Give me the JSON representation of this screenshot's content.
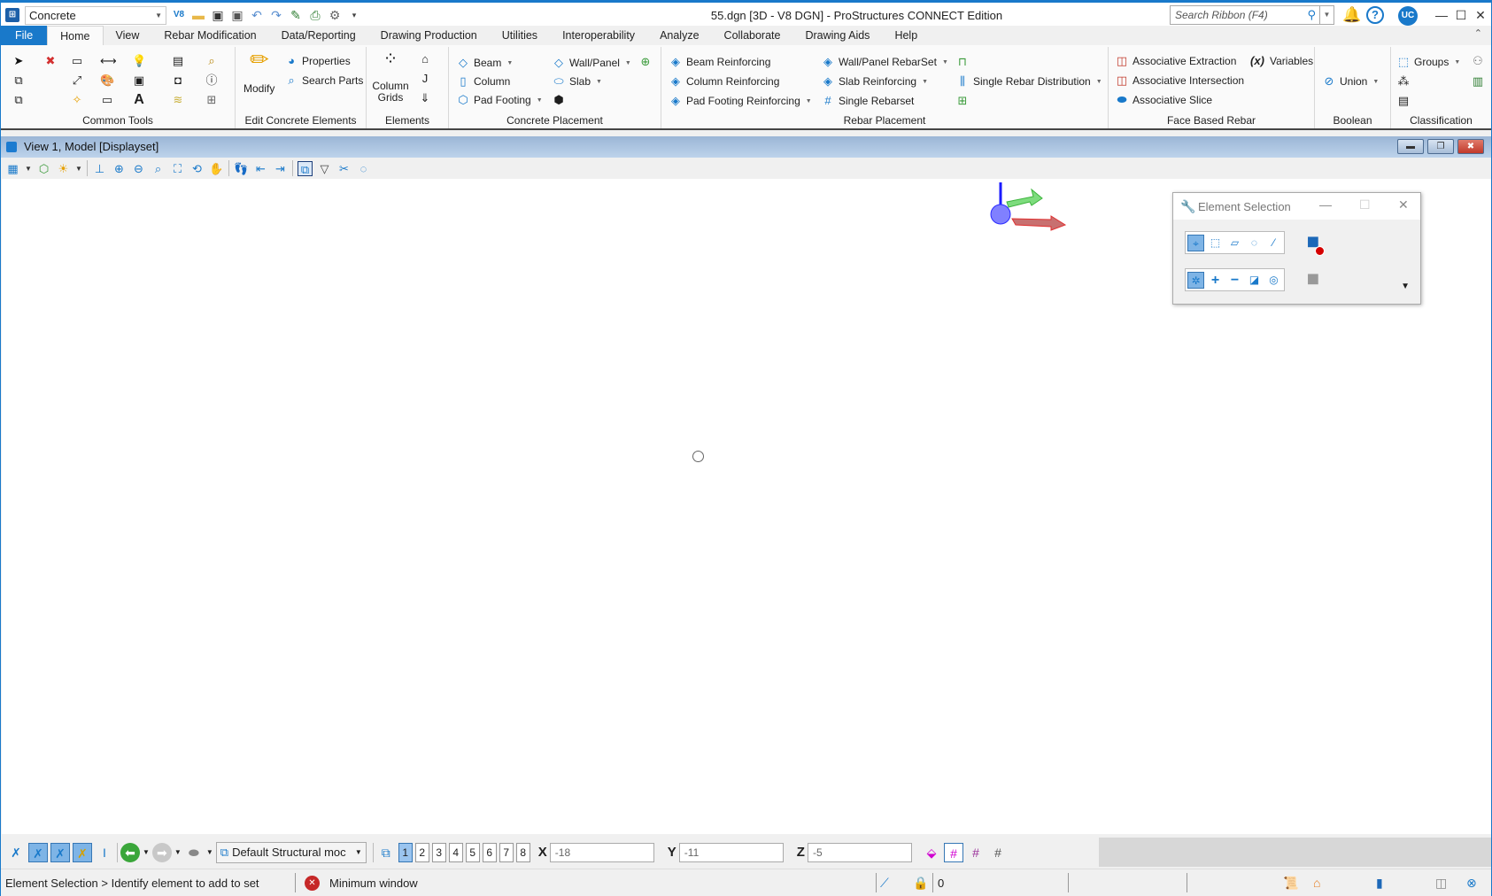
{
  "titlebar": {
    "workflow": "Concrete",
    "window_title": "55.dgn [3D - V8 DGN] - ProStructures CONNECT Edition",
    "search_placeholder": "Search Ribbon (F4)",
    "user_initials": "UC",
    "qat_icons": [
      "v8-icon",
      "open-folder-icon",
      "save-icon",
      "save-settings-icon",
      "undo-icon",
      "redo-icon",
      "pin-icon",
      "print-icon",
      "properties-doc-icon",
      "customize-icon"
    ]
  },
  "tabs": [
    {
      "label": "File"
    },
    {
      "label": "Home"
    },
    {
      "label": "View"
    },
    {
      "label": "Rebar Modification"
    },
    {
      "label": "Data/Reporting"
    },
    {
      "label": "Drawing Production"
    },
    {
      "label": "Utilities"
    },
    {
      "label": "Interoperability"
    },
    {
      "label": "Analyze"
    },
    {
      "label": "Collaborate"
    },
    {
      "label": "Drawing Aids"
    },
    {
      "label": "Help"
    }
  ],
  "ribbon": {
    "groups": {
      "common_tools": "Common Tools",
      "edit_concrete": "Edit Concrete Elements",
      "elements": "Elements",
      "concrete_placement": "Concrete Placement",
      "rebar_placement": "Rebar Placement",
      "face_based_rebar": "Face Based Rebar",
      "boolean": "Boolean",
      "classification": "Classification"
    },
    "edit_concrete": {
      "modify": "Modify",
      "properties": "Properties",
      "search_parts": "Search Parts"
    },
    "elements": {
      "column_grids_1": "Column",
      "column_grids_2": "Grids"
    },
    "concrete_placement": {
      "beam": "Beam",
      "column": "Column",
      "pad_footing": "Pad Footing",
      "wall_panel": "Wall/Panel",
      "slab": "Slab"
    },
    "rebar_placement": {
      "beam_reinforcing": "Beam Reinforcing",
      "column_reinforcing": "Column Reinforcing",
      "pad_footing_reinforcing": "Pad Footing Reinforcing",
      "wall_panel_rebarset": "Wall/Panel RebarSet",
      "slab_reinforcing": "Slab Reinforcing",
      "single_rebarset": "Single Rebarset",
      "single_rebar_distribution": "Single Rebar Distribution"
    },
    "face_based_rebar": {
      "assoc_extraction": "Associative Extraction",
      "assoc_intersection": "Associative Intersection",
      "assoc_slice": "Associative Slice",
      "variables": "Variables"
    },
    "boolean": {
      "union": "Union"
    },
    "classification": {
      "groups": "Groups"
    }
  },
  "view": {
    "title": "View 1, Model [Displayset]"
  },
  "element_selection": {
    "title": "Element Selection",
    "methods": [
      "individual",
      "block",
      "shape",
      "circle",
      "line"
    ],
    "modes": [
      "new",
      "add",
      "subtract",
      "invert",
      "clear"
    ],
    "selected_method": "individual",
    "selected_mode": "new"
  },
  "bottom_toolbar": {
    "model_combo": "Default Structural moc",
    "views": [
      "1",
      "2",
      "3",
      "4",
      "5",
      "6",
      "7",
      "8"
    ],
    "active_view": "1",
    "x_label": "X",
    "x_value": "-18",
    "y_label": "Y",
    "y_value": "-11",
    "z_label": "Z",
    "z_value": "-5"
  },
  "statusbar": {
    "prompt": "Element Selection > Identify element to add to set",
    "message": "Minimum window",
    "selection_count": "0"
  }
}
